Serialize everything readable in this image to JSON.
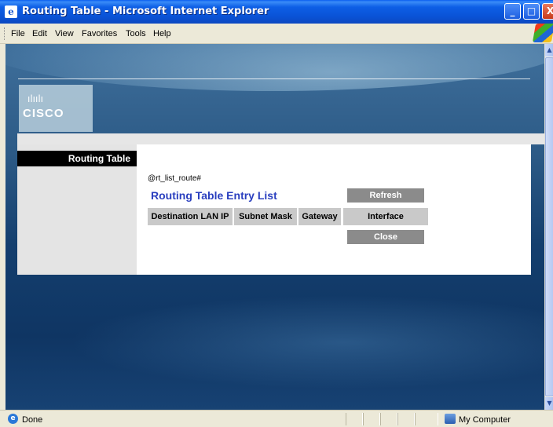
{
  "window": {
    "title": "Routing Table - Microsoft Internet Explorer",
    "icon": "ie-icon",
    "controls": {
      "minimize": "_",
      "maximize": "□",
      "close": "X"
    }
  },
  "menubar": {
    "items": [
      "File",
      "Edit",
      "View",
      "Favorites",
      "Tools",
      "Help"
    ]
  },
  "page": {
    "logo_text": "CISCO",
    "logo_bars": "ılıılı",
    "sidebar_title": "Routing Table",
    "template_marker": "@rt_list_route#",
    "heading": "Routing Table Entry List",
    "buttons": {
      "refresh": "Refresh",
      "close": "Close"
    },
    "table": {
      "columns": [
        "Destination LAN IP",
        "Subnet Mask",
        "Gateway",
        "Interface"
      ]
    }
  },
  "statusbar": {
    "status": "Done",
    "zone": "My Computer"
  },
  "colors": {
    "heading": "#2a3fbf",
    "button_bg": "#8b8b8b",
    "header_bg": "#c9c9c9",
    "sidebar_head_bg": "#000000"
  }
}
